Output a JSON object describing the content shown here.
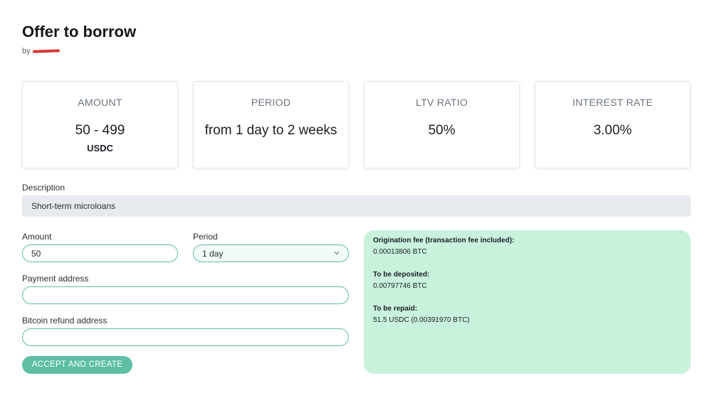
{
  "header": {
    "title": "Offer to borrow",
    "by_label": "by"
  },
  "stats": [
    {
      "label": "AMOUNT",
      "value": "50 - 499",
      "unit": "USDC"
    },
    {
      "label": "PERIOD",
      "value": "from 1 day to 2 weeks",
      "unit": ""
    },
    {
      "label": "LTV RATIO",
      "value": "50%",
      "unit": ""
    },
    {
      "label": "INTEREST RATE",
      "value": "3.00%",
      "unit": ""
    }
  ],
  "description": {
    "label": "Description",
    "text": "Short-term microloans"
  },
  "form": {
    "amount_label": "Amount",
    "amount_value": "50",
    "period_label": "Period",
    "period_value": "1 day",
    "payment_address_label": "Payment address",
    "payment_address_value": "",
    "refund_address_label": "Bitcoin refund address",
    "refund_address_value": "",
    "submit_label": "ACCEPT AND CREATE"
  },
  "summary": {
    "origination_fee_label": "Origination fee (transaction fee included):",
    "origination_fee_value": "0.00013806 BTC",
    "deposit_label": "To be deposited:",
    "deposit_value": "0.00797746 BTC",
    "repay_label": "To be repaid:",
    "repay_value": "51.5 USDC (0.00391970 BTC)"
  },
  "colors": {
    "accent": "#5ebfa5",
    "summary_bg": "#c9f2dd",
    "description_bg": "#e6e9ee",
    "redaction": "#d9383a"
  }
}
